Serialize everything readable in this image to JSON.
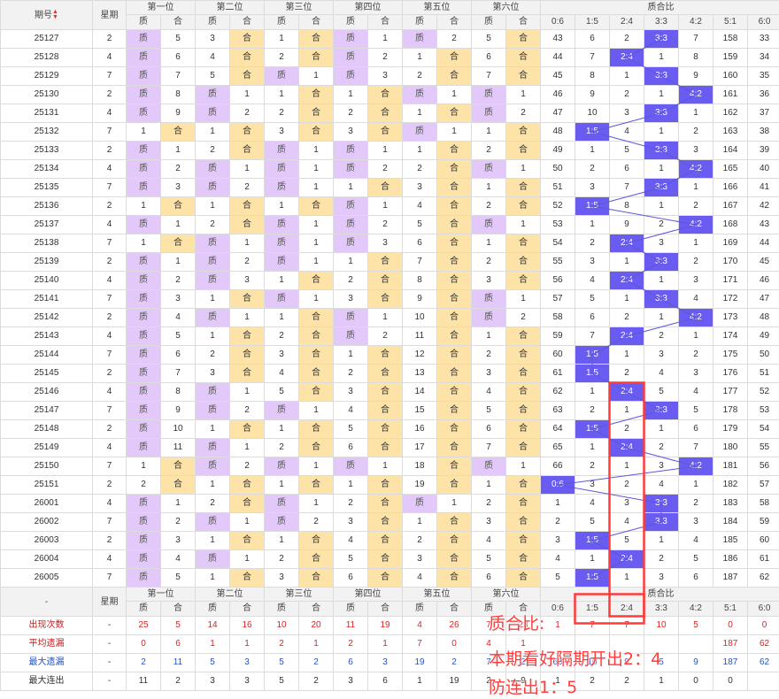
{
  "header": {
    "period": "期号",
    "weekday": "星期",
    "positions": [
      "第一位",
      "第二位",
      "第三位",
      "第四位",
      "第五位",
      "第六位"
    ],
    "ratio_group": "质合比",
    "zhi": "质",
    "he": "合",
    "ratios": [
      "0:6",
      "1:5",
      "2:4",
      "3:3",
      "4:2",
      "5:1",
      "6:0"
    ]
  },
  "rows": [
    {
      "p": "25127",
      "w": "2",
      "c": [
        "Z",
        "5",
        "3",
        "H",
        "1",
        "H",
        "Z",
        "1",
        "Z",
        "2",
        "5",
        "H"
      ],
      "r": [
        "43",
        "6",
        "2",
        "3:3",
        "7",
        "158",
        "33"
      ],
      "hit": 3
    },
    {
      "p": "25128",
      "w": "4",
      "c": [
        "Z",
        "6",
        "4",
        "H",
        "2",
        "H",
        "Z",
        "2",
        "1",
        "H",
        "6",
        "H"
      ],
      "r": [
        "44",
        "7",
        "2:4",
        "1",
        "8",
        "159",
        "34"
      ],
      "hit": 2
    },
    {
      "p": "25129",
      "w": "7",
      "c": [
        "Z",
        "7",
        "5",
        "H",
        "Z",
        "1",
        "Z",
        "3",
        "2",
        "H",
        "7",
        "H"
      ],
      "r": [
        "45",
        "8",
        "1",
        "3:3",
        "9",
        "160",
        "35"
      ],
      "hit": 3
    },
    {
      "p": "25130",
      "w": "2",
      "c": [
        "Z",
        "8",
        "Z",
        "1",
        "1",
        "H",
        "1",
        "H",
        "Z",
        "1",
        "Z",
        "1"
      ],
      "r": [
        "46",
        "9",
        "2",
        "1",
        "4:2",
        "161",
        "36"
      ],
      "hit": 4
    },
    {
      "p": "25131",
      "w": "4",
      "c": [
        "Z",
        "9",
        "Z",
        "2",
        "2",
        "H",
        "2",
        "H",
        "1",
        "H",
        "Z",
        "2"
      ],
      "r": [
        "47",
        "10",
        "3",
        "3:3",
        "1",
        "162",
        "37"
      ],
      "hit": 3
    },
    {
      "p": "25132",
      "w": "7",
      "c": [
        "1",
        "H",
        "1",
        "H",
        "3",
        "H",
        "3",
        "H",
        "Z",
        "1",
        "1",
        "H"
      ],
      "r": [
        "48",
        "1:5",
        "4",
        "1",
        "2",
        "163",
        "38"
      ],
      "hit": 1,
      "sep": true
    },
    {
      "p": "25133",
      "w": "2",
      "c": [
        "Z",
        "1",
        "2",
        "H",
        "Z",
        "1",
        "Z",
        "1",
        "1",
        "H",
        "2",
        "H"
      ],
      "r": [
        "49",
        "1",
        "5",
        "3:3",
        "3",
        "164",
        "39"
      ],
      "hit": 3
    },
    {
      "p": "25134",
      "w": "4",
      "c": [
        "Z",
        "2",
        "Z",
        "1",
        "Z",
        "1",
        "Z",
        "2",
        "2",
        "H",
        "Z",
        "1"
      ],
      "r": [
        "50",
        "2",
        "6",
        "1",
        "4:2",
        "165",
        "40"
      ],
      "hit": 4
    },
    {
      "p": "25135",
      "w": "7",
      "c": [
        "Z",
        "3",
        "Z",
        "2",
        "Z",
        "1",
        "1",
        "H",
        "3",
        "H",
        "1",
        "H"
      ],
      "r": [
        "51",
        "3",
        "7",
        "3:3",
        "1",
        "166",
        "41"
      ],
      "hit": 3
    },
    {
      "p": "25136",
      "w": "2",
      "c": [
        "1",
        "H",
        "1",
        "H",
        "1",
        "H",
        "Z",
        "1",
        "4",
        "H",
        "2",
        "H"
      ],
      "r": [
        "52",
        "1:5",
        "8",
        "1",
        "2",
        "167",
        "42"
      ],
      "hit": 1
    },
    {
      "p": "25137",
      "w": "4",
      "c": [
        "Z",
        "1",
        "2",
        "H",
        "Z",
        "1",
        "Z",
        "2",
        "5",
        "H",
        "Z",
        "1"
      ],
      "r": [
        "53",
        "1",
        "9",
        "2",
        "4:2",
        "168",
        "43"
      ],
      "hit": 4,
      "sep": true
    },
    {
      "p": "25138",
      "w": "7",
      "c": [
        "1",
        "H",
        "Z",
        "1",
        "Z",
        "1",
        "Z",
        "3",
        "6",
        "H",
        "1",
        "H"
      ],
      "r": [
        "54",
        "2",
        "2:4",
        "3",
        "1",
        "169",
        "44"
      ],
      "hit": 2
    },
    {
      "p": "25139",
      "w": "2",
      "c": [
        "Z",
        "1",
        "Z",
        "2",
        "Z",
        "1",
        "1",
        "H",
        "7",
        "H",
        "2",
        "H"
      ],
      "r": [
        "55",
        "3",
        "1",
        "3:3",
        "2",
        "170",
        "45"
      ],
      "hit": 3
    },
    {
      "p": "25140",
      "w": "4",
      "c": [
        "Z",
        "2",
        "Z",
        "3",
        "1",
        "H",
        "2",
        "H",
        "8",
        "H",
        "3",
        "H"
      ],
      "r": [
        "56",
        "4",
        "2:4",
        "1",
        "3",
        "171",
        "46"
      ],
      "hit": 2
    },
    {
      "p": "25141",
      "w": "7",
      "c": [
        "Z",
        "3",
        "1",
        "H",
        "Z",
        "1",
        "3",
        "H",
        "9",
        "H",
        "Z",
        "1"
      ],
      "r": [
        "57",
        "5",
        "1",
        "3:3",
        "4",
        "172",
        "47"
      ],
      "hit": 3
    },
    {
      "p": "25142",
      "w": "2",
      "c": [
        "Z",
        "4",
        "Z",
        "1",
        "1",
        "H",
        "Z",
        "1",
        "10",
        "H",
        "Z",
        "2"
      ],
      "r": [
        "58",
        "6",
        "2",
        "1",
        "4:2",
        "173",
        "48"
      ],
      "hit": 4,
      "sep": true
    },
    {
      "p": "25143",
      "w": "4",
      "c": [
        "Z",
        "5",
        "1",
        "H",
        "2",
        "H",
        "Z",
        "2",
        "11",
        "H",
        "1",
        "H"
      ],
      "r": [
        "59",
        "7",
        "2:4",
        "2",
        "1",
        "174",
        "49"
      ],
      "hit": 2
    },
    {
      "p": "25144",
      "w": "7",
      "c": [
        "Z",
        "6",
        "2",
        "H",
        "3",
        "H",
        "1",
        "H",
        "12",
        "H",
        "2",
        "H"
      ],
      "r": [
        "60",
        "1:5",
        "1",
        "3",
        "2",
        "175",
        "50"
      ],
      "hit": 1
    },
    {
      "p": "25145",
      "w": "2",
      "c": [
        "Z",
        "7",
        "3",
        "H",
        "4",
        "H",
        "2",
        "H",
        "13",
        "H",
        "3",
        "H"
      ],
      "r": [
        "61",
        "1:5",
        "2",
        "4",
        "3",
        "176",
        "51"
      ],
      "hit": 1
    },
    {
      "p": "25146",
      "w": "4",
      "c": [
        "Z",
        "8",
        "Z",
        "1",
        "5",
        "H",
        "3",
        "H",
        "14",
        "H",
        "4",
        "H"
      ],
      "r": [
        "62",
        "1",
        "2:4",
        "5",
        "4",
        "177",
        "52"
      ],
      "hit": 2
    },
    {
      "p": "25147",
      "w": "7",
      "c": [
        "Z",
        "9",
        "Z",
        "2",
        "Z",
        "1",
        "4",
        "H",
        "15",
        "H",
        "5",
        "H"
      ],
      "r": [
        "63",
        "2",
        "1",
        "3:3",
        "5",
        "178",
        "53"
      ],
      "hit": 3,
      "sep": true
    },
    {
      "p": "25148",
      "w": "2",
      "c": [
        "Z",
        "10",
        "1",
        "H",
        "1",
        "H",
        "5",
        "H",
        "16",
        "H",
        "6",
        "H"
      ],
      "r": [
        "64",
        "1:5",
        "2",
        "1",
        "6",
        "179",
        "54"
      ],
      "hit": 1
    },
    {
      "p": "25149",
      "w": "4",
      "c": [
        "Z",
        "11",
        "Z",
        "1",
        "2",
        "H",
        "6",
        "H",
        "17",
        "H",
        "7",
        "H"
      ],
      "r": [
        "65",
        "1",
        "2:4",
        "2",
        "7",
        "180",
        "55"
      ],
      "hit": 2
    },
    {
      "p": "25150",
      "w": "7",
      "c": [
        "1",
        "H",
        "Z",
        "2",
        "Z",
        "1",
        "Z",
        "1",
        "18",
        "H",
        "Z",
        "1"
      ],
      "r": [
        "66",
        "2",
        "1",
        "3",
        "4:2",
        "181",
        "56"
      ],
      "hit": 4
    },
    {
      "p": "25151",
      "w": "2",
      "c": [
        "2",
        "H",
        "1",
        "H",
        "1",
        "H",
        "1",
        "H",
        "19",
        "H",
        "1",
        "H"
      ],
      "r": [
        "0:6",
        "3",
        "2",
        "4",
        "1",
        "182",
        "57"
      ],
      "hit": 0
    },
    {
      "p": "26001",
      "w": "4",
      "c": [
        "Z",
        "1",
        "2",
        "H",
        "Z",
        "1",
        "2",
        "H",
        "Z",
        "1",
        "2",
        "H"
      ],
      "r": [
        "1",
        "4",
        "3",
        "3:3",
        "2",
        "183",
        "58"
      ],
      "hit": 3,
      "sep": true
    },
    {
      "p": "26002",
      "w": "7",
      "c": [
        "Z",
        "2",
        "Z",
        "1",
        "Z",
        "2",
        "3",
        "H",
        "1",
        "H",
        "3",
        "H"
      ],
      "r": [
        "2",
        "5",
        "4",
        "3:3",
        "3",
        "184",
        "59"
      ],
      "hit": 3
    },
    {
      "p": "26003",
      "w": "2",
      "c": [
        "Z",
        "3",
        "1",
        "H",
        "1",
        "H",
        "4",
        "H",
        "2",
        "H",
        "4",
        "H"
      ],
      "r": [
        "3",
        "1:5",
        "5",
        "1",
        "4",
        "185",
        "60"
      ],
      "hit": 1
    },
    {
      "p": "26004",
      "w": "4",
      "c": [
        "Z",
        "4",
        "Z",
        "1",
        "2",
        "H",
        "5",
        "H",
        "3",
        "H",
        "5",
        "H"
      ],
      "r": [
        "4",
        "1",
        "2:4",
        "2",
        "5",
        "186",
        "61"
      ],
      "hit": 2
    },
    {
      "p": "26005",
      "w": "7",
      "c": [
        "Z",
        "5",
        "1",
        "H",
        "3",
        "H",
        "6",
        "H",
        "4",
        "H",
        "6",
        "H"
      ],
      "r": [
        "5",
        "1:5",
        "1",
        "3",
        "6",
        "187",
        "62"
      ],
      "hit": 1
    }
  ],
  "footer": {
    "dash": "-",
    "weekday": "星期"
  },
  "stats": [
    {
      "label": "出现次数",
      "dash": "-",
      "vals": [
        "25",
        "5",
        "14",
        "16",
        "10",
        "20",
        "11",
        "19",
        "4",
        "26",
        "7",
        "23",
        "1",
        "7",
        "7",
        "10",
        "5",
        "0",
        "0"
      ],
      "tone": "red"
    },
    {
      "label": "平均遗漏",
      "dash": "-",
      "vals": [
        "0",
        "6",
        "1",
        "1",
        "2",
        "1",
        "2",
        "1",
        "7",
        "0",
        "4",
        "1",
        "",
        "",
        "",
        "",
        "",
        "187",
        "62"
      ],
      "tone": "red"
    },
    {
      "label": "最大遗漏",
      "dash": "-",
      "vals": [
        "2",
        "11",
        "5",
        "3",
        "5",
        "2",
        "6",
        "3",
        "19",
        "2",
        "7",
        "2",
        "66",
        "10",
        "9",
        "5",
        "9",
        "187",
        "62"
      ],
      "tone": "blue"
    },
    {
      "label": "最大连出",
      "dash": "-",
      "vals": [
        "11",
        "2",
        "3",
        "3",
        "5",
        "2",
        "3",
        "6",
        "1",
        "19",
        "2",
        "9",
        "1",
        "2",
        "2",
        "1",
        "0",
        "0",
        ""
      ],
      "tone": "dark"
    }
  ],
  "annotation": {
    "line1": "质合比:",
    "line2": "本期看好隔期开出2：4",
    "line3": "防连出1：5",
    "color": "#ff3b3b"
  },
  "colors": {
    "zhi_bg": "#e3c8fa",
    "he_bg": "#fde3a8",
    "ratio_hit": "#6b5cf1"
  }
}
